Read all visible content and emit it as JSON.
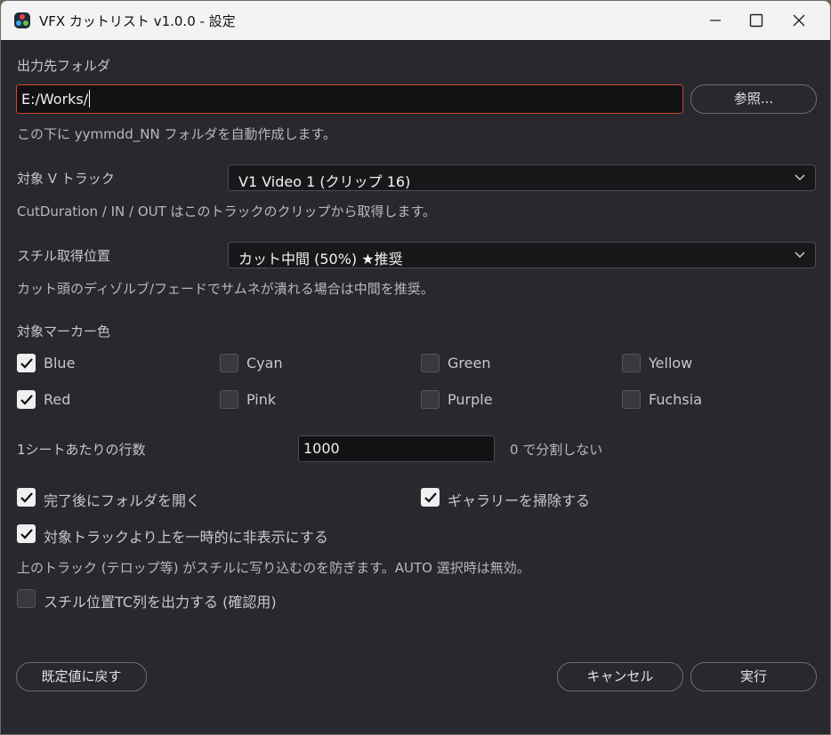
{
  "window": {
    "title": "VFX カットリスト  v1.0.0  -  設定"
  },
  "output_folder": {
    "label": "出力先フォルダ",
    "value": "E:/Works/",
    "browse_label": "参照...",
    "hint": "この下に yymmdd_NN フォルダを自動作成します。"
  },
  "track": {
    "label": "対象 V トラック",
    "selected": "V1   Video 1   (クリップ 16)",
    "hint": "CutDuration / IN / OUT はこのトラックのクリップから取得します。"
  },
  "still": {
    "label": "スチル取得位置",
    "selected": "カット中間 (50%)  ★推奨",
    "hint": "カット頭のディゾルブ/フェードでサムネが潰れる場合は中間を推奨。"
  },
  "markers": {
    "label": "対象マーカー色",
    "items": [
      {
        "label": "Blue",
        "checked": true
      },
      {
        "label": "Cyan",
        "checked": false
      },
      {
        "label": "Green",
        "checked": false
      },
      {
        "label": "Yellow",
        "checked": false
      },
      {
        "label": "Red",
        "checked": true
      },
      {
        "label": "Pink",
        "checked": false
      },
      {
        "label": "Purple",
        "checked": false
      },
      {
        "label": "Fuchsia",
        "checked": false
      }
    ]
  },
  "rows": {
    "label": "1シートあたりの行数",
    "value": "1000",
    "hint": "0 で分割しない"
  },
  "options": {
    "open_folder": {
      "label": "完了後にフォルダを開く",
      "checked": true
    },
    "clear_gallery": {
      "label": "ギャラリーを掃除する",
      "checked": true
    },
    "hide_upper": {
      "label": "対象トラックより上を一時的に非表示にする",
      "checked": true
    },
    "hide_upper_hint": "上のトラック (テロップ等) がスチルに写り込むのを防ぎます。AUTO 選択時は無効。",
    "still_tc": {
      "label": "スチル位置TC列を出力する (確認用)",
      "checked": false
    }
  },
  "footer": {
    "reset_label": "既定値に戻す",
    "cancel_label": "キャンセル",
    "run_label": "実行"
  },
  "colors": {
    "accent_focus": "#d2452f",
    "background": "#28282e"
  }
}
